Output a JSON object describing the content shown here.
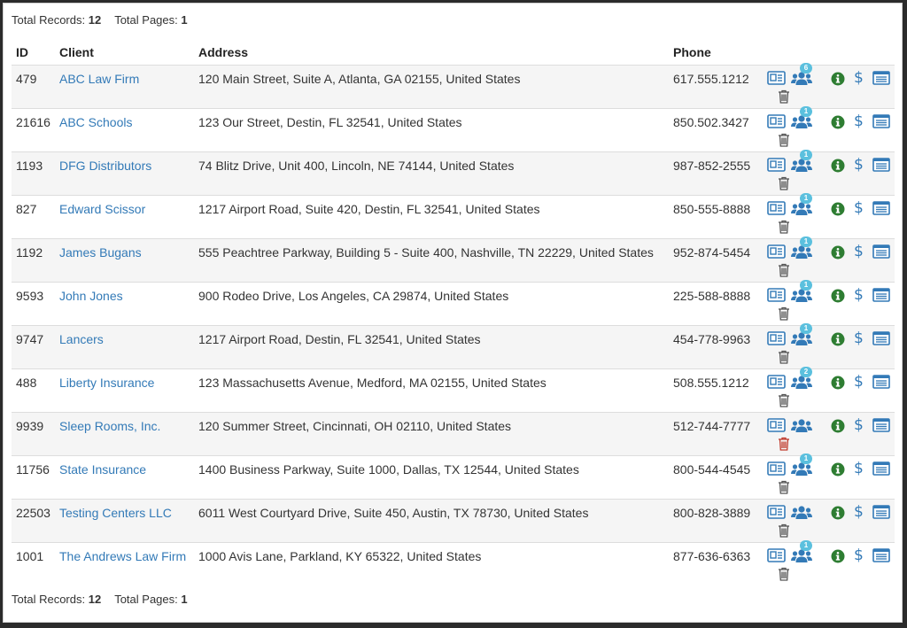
{
  "summary": {
    "records_label": "Total Records:",
    "records_value": "12",
    "pages_label": "Total Pages:",
    "pages_value": "1"
  },
  "columns": {
    "id": "ID",
    "client": "Client",
    "address": "Address",
    "phone": "Phone"
  },
  "colors": {
    "link": "#337ab7",
    "info": "#2e7d32",
    "trash_disabled": "#555555",
    "trash_active": "#c0392b",
    "badge": "#5bc0de"
  },
  "icons": {
    "card": "address-card-icon",
    "users": "users-icon",
    "trash": "trash-icon",
    "info": "info-icon",
    "dollar": "dollar-icon",
    "list": "list-icon"
  },
  "dollar_glyph": "$",
  "rows": [
    {
      "id": "479",
      "client": "ABC Law Firm",
      "address": "120 Main Street, Suite A, Atlanta, GA 02155, United States",
      "phone": "617.555.1212",
      "badge": "6",
      "trash_red": false
    },
    {
      "id": "21616",
      "client": "ABC Schools",
      "address": "123 Our Street, Destin, FL 32541, United States",
      "phone": "850.502.3427",
      "badge": "1",
      "trash_red": false
    },
    {
      "id": "1193",
      "client": "DFG Distributors",
      "address": "74 Blitz Drive, Unit 400, Lincoln, NE 74144, United States",
      "phone": "987-852-2555",
      "badge": "1",
      "trash_red": false
    },
    {
      "id": "827",
      "client": "Edward Scissor",
      "address": "1217 Airport Road, Suite 420, Destin, FL 32541, United States",
      "phone": "850-555-8888",
      "badge": "1",
      "trash_red": false
    },
    {
      "id": "1192",
      "client": "James Bugans",
      "address": "555 Peachtree Parkway, Building 5 - Suite 400, Nashville, TN 22229, United States",
      "phone": "952-874-5454",
      "badge": "1",
      "trash_red": false
    },
    {
      "id": "9593",
      "client": "John Jones",
      "address": "900 Rodeo Drive, Los Angeles, CA 29874, United States",
      "phone": "225-588-8888",
      "badge": "1",
      "trash_red": false
    },
    {
      "id": "9747",
      "client": "Lancers",
      "address": "1217 Airport Road, Destin, FL 32541, United States",
      "phone": "454-778-9963",
      "badge": "1",
      "trash_red": false
    },
    {
      "id": "488",
      "client": "Liberty Insurance",
      "address": "123 Massachusetts Avenue, Medford, MA 02155, United States",
      "phone": "508.555.1212",
      "badge": "2",
      "trash_red": false
    },
    {
      "id": "9939",
      "client": "Sleep Rooms, Inc.",
      "address": "120 Summer Street, Cincinnati, OH 02110, United States",
      "phone": "512-744-7777",
      "badge": "",
      "trash_red": true
    },
    {
      "id": "11756",
      "client": "State Insurance",
      "address": "1400 Business Parkway, Suite 1000, Dallas, TX 12544, United States",
      "phone": "800-544-4545",
      "badge": "1",
      "trash_red": false
    },
    {
      "id": "22503",
      "client": "Testing Centers LLC",
      "address": "6011 West Courtyard Drive, Suite 450, Austin, TX 78730, United States",
      "phone": "800-828-3889",
      "badge": "",
      "trash_red": false
    },
    {
      "id": "1001",
      "client": "The Andrews Law Firm",
      "address": "1000 Avis Lane, Parkland, KY 65322, United States",
      "phone": "877-636-6363",
      "badge": "1",
      "trash_red": false
    }
  ]
}
